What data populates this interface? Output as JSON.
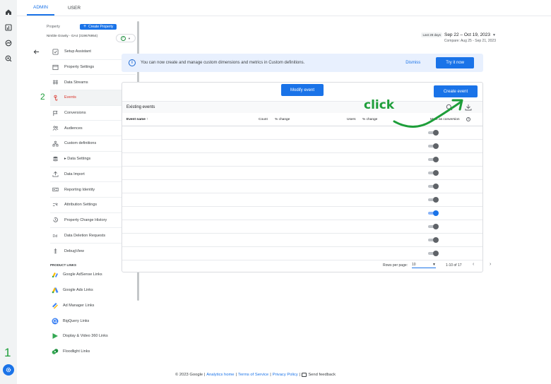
{
  "tabs": [
    {
      "label": "ADMIN",
      "active": true
    },
    {
      "label": "USER",
      "active": false
    }
  ],
  "rail_icons": [
    "home-icon",
    "reports-icon",
    "explore-icon",
    "advertising-icon"
  ],
  "annotations": {
    "step1": "1",
    "step2": "2",
    "click": "click"
  },
  "property": {
    "label": "Property",
    "create_label": "Create Property",
    "name": "Nimble Gravity - GA4 (319676954)"
  },
  "sidebar": {
    "items": [
      {
        "label": "Setup Assistant",
        "icon": "checklist-icon"
      },
      {
        "label": "Property Settings",
        "icon": "settings-box-icon"
      },
      {
        "label": "Data Streams",
        "icon": "streams-icon"
      },
      {
        "label": "Events",
        "icon": "touch-icon",
        "active": true
      },
      {
        "label": "Conversions",
        "icon": "flag-icon"
      },
      {
        "label": "Audiences",
        "icon": "audiences-icon"
      },
      {
        "label": "Custom definitions",
        "icon": "custom-definitions-icon"
      },
      {
        "label": "▸ Data Settings",
        "icon": "database-icon"
      },
      {
        "label": "Data Import",
        "icon": "upload-icon"
      },
      {
        "label": "Reporting Identity",
        "icon": "identity-icon"
      },
      {
        "label": "Attribution Settings",
        "icon": "attribution-icon"
      },
      {
        "label": "Property Change History",
        "icon": "history-icon"
      },
      {
        "label": "Data Deletion Requests",
        "icon": "deletion-icon"
      },
      {
        "label": "DebugView",
        "icon": "debug-icon"
      }
    ],
    "section_header": "PRODUCT LINKS",
    "links": [
      {
        "label": "Google AdSense Links",
        "icon": "adsense-icon"
      },
      {
        "label": "Google Ads Links",
        "icon": "google-ads-icon"
      },
      {
        "label": "Ad Manager Links",
        "icon": "ad-manager-icon"
      },
      {
        "label": "BigQuery Links",
        "icon": "bigquery-icon"
      },
      {
        "label": "Display & Video 360 Links",
        "icon": "dv360-icon"
      },
      {
        "label": "Floodlight Links",
        "icon": "floodlight-icon"
      }
    ]
  },
  "date": {
    "badge": "Last 28 days",
    "range": "Sep 22 – Oct 19, 2023",
    "compare": "Compare: Aug 25 - Sep 21, 2023"
  },
  "banner": {
    "text": "You can now create and manage custom dimensions and metrics in Custom definitions.",
    "dismiss": "Dismiss",
    "try": "Try it now"
  },
  "events": {
    "modify_label": "Modify event",
    "create_label": "Create event",
    "section_title": "Existing events",
    "columns": {
      "name": "Event name ↑",
      "count": "Count",
      "pct1": "% change",
      "users": "Users",
      "pct2": "% change",
      "conversion": "Mark as conversion"
    },
    "toggles": [
      false,
      false,
      false,
      false,
      false,
      false,
      true,
      false,
      false,
      false
    ],
    "rows_per_page_label": "Rows per page:",
    "rows_per_page": "10",
    "range": "1-10 of 17"
  },
  "footer": {
    "copyright": "© 2023 Google |",
    "analytics_home": "Analytics home",
    "sep1": "|",
    "terms": "Terms of Service",
    "sep2": "|",
    "privacy": "Privacy Policy",
    "sep3": "|",
    "feedback": "Send feedback"
  },
  "colors": {
    "accent": "#1a73e8",
    "annotation": "#1e9e3a",
    "active_nav": "#d93025"
  }
}
